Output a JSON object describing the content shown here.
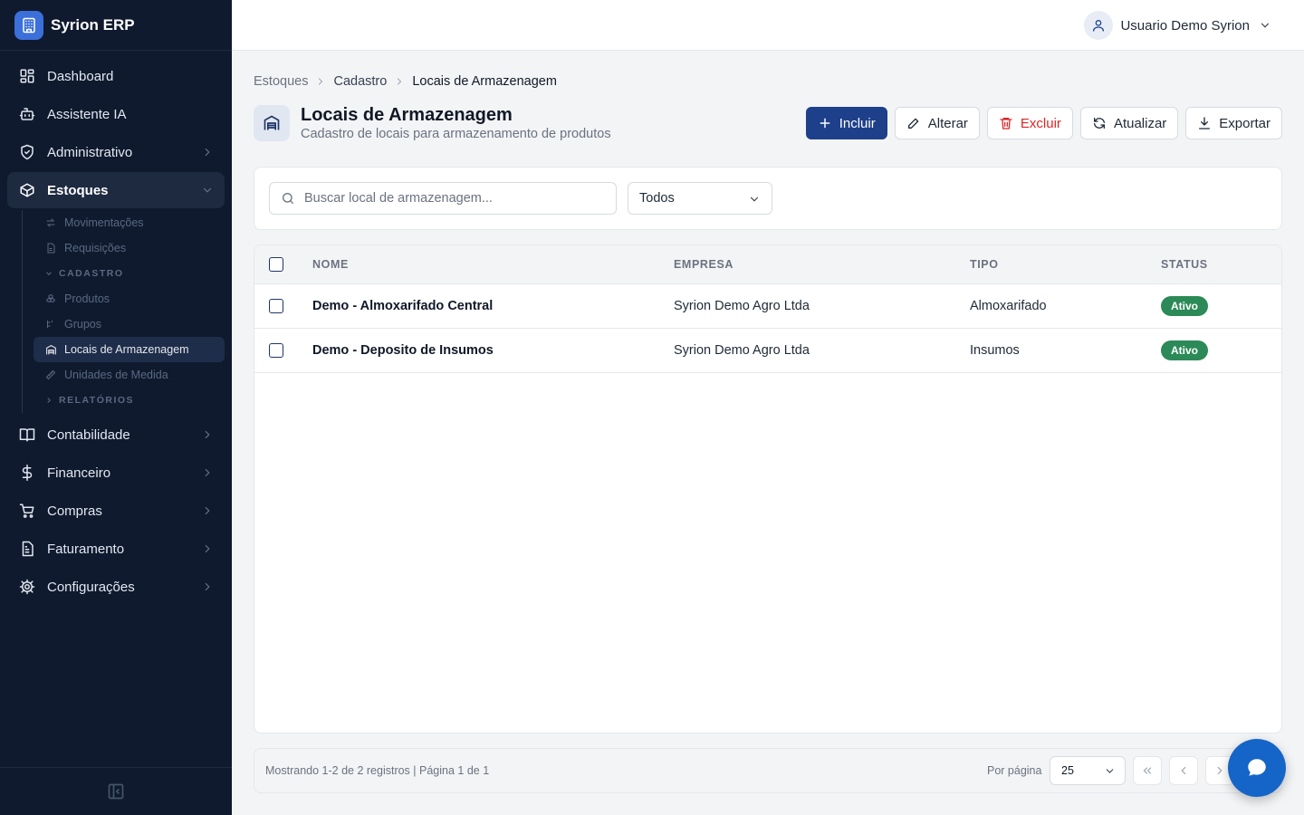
{
  "app": {
    "name": "Syrion ERP"
  },
  "sidebar": {
    "items": [
      {
        "label": "Dashboard",
        "icon": "dashboard-icon"
      },
      {
        "label": "Assistente IA",
        "icon": "bot-icon"
      },
      {
        "label": "Administrativo",
        "icon": "shield-icon"
      },
      {
        "label": "Estoques",
        "icon": "package-icon"
      },
      {
        "label": "Contabilidade",
        "icon": "book-icon"
      },
      {
        "label": "Financeiro",
        "icon": "dollar-icon"
      },
      {
        "label": "Compras",
        "icon": "cart-icon"
      },
      {
        "label": "Faturamento",
        "icon": "invoice-icon"
      },
      {
        "label": "Configurações",
        "icon": "gear-icon"
      }
    ],
    "estoques_sub": {
      "movimentacoes": "Movimentações",
      "requisicoes": "Requisições",
      "cadastro_section": "Cadastro",
      "produtos": "Produtos",
      "grupos": "Grupos",
      "locais": "Locais de Armazenagem",
      "unidades": "Unidades de Medida",
      "relatorios_section": "Relatórios"
    }
  },
  "topbar": {
    "user_name": "Usuario Demo Syrion"
  },
  "breadcrumb": [
    "Estoques",
    "Cadastro",
    "Locais de Armazenagem"
  ],
  "page": {
    "title": "Locais de Armazenagem",
    "subtitle": "Cadastro de locais para armazenamento de produtos"
  },
  "actions": {
    "incluir": "Incluir",
    "alterar": "Alterar",
    "excluir": "Excluir",
    "atualizar": "Atualizar",
    "exportar": "Exportar"
  },
  "filters": {
    "search_placeholder": "Buscar local de armazenagem...",
    "search_value": "",
    "status_filter": "Todos"
  },
  "table": {
    "columns": [
      "Nome",
      "Empresa",
      "Tipo",
      "Status"
    ],
    "rows": [
      {
        "nome": "Demo - Almoxarifado Central",
        "empresa": "Syrion Demo Agro Ltda",
        "tipo": "Almoxarifado",
        "status": "Ativo"
      },
      {
        "nome": "Demo - Deposito de Insumos",
        "empresa": "Syrion Demo Agro Ltda",
        "tipo": "Insumos",
        "status": "Ativo"
      }
    ]
  },
  "pagination": {
    "info": "Mostrando 1-2 de 2 registros | Página 1 de 1",
    "per_page_label": "Por página",
    "per_page": "25"
  },
  "colors": {
    "sidebar_bg": "#0f1a2e",
    "primary": "#1e3f8a",
    "danger": "#dc2626",
    "status_active": "#2b8a57",
    "chat_fab": "#1565c8"
  }
}
